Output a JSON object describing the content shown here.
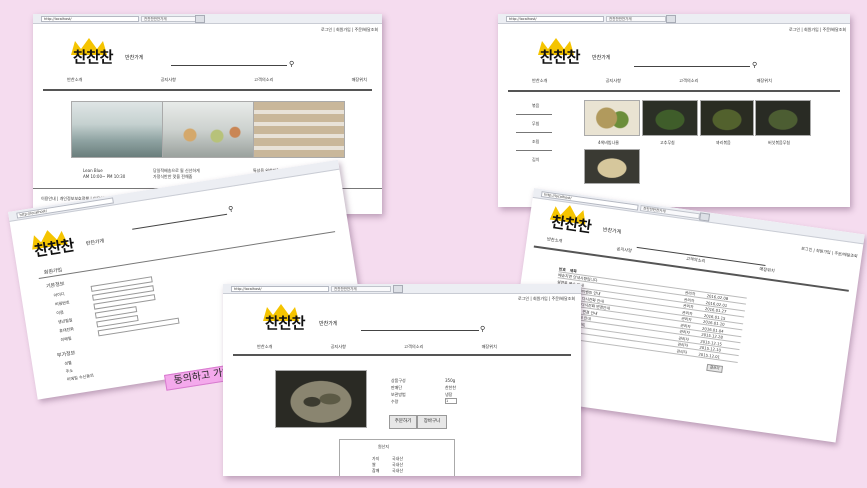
{
  "site": {
    "logo_text": "찬찬찬",
    "logo_sub": "반찬가게",
    "url": "http://localhost/",
    "tab_title": "찬찬찬반찬가게"
  },
  "top_links": "로그인 | 회원가입 | 주문/배달조회",
  "menu": [
    "반찬소개",
    "공지사항",
    "고객의소리",
    "매장위치"
  ],
  "home": {
    "store_info": [
      "Lean Blue",
      "AM 10:00~ PM 10:30"
    ],
    "notice_items": [
      "당일적배송으로 될 신선하게",
      "가정식반찬 맛을 전해줌"
    ],
    "extra_items": [
      "특성을 위한반?",
      "PM 2:00~ 오대반찬 판매"
    ],
    "footer_links": "이용안내 | 개인정보보호정책 | 이용약관"
  },
  "menu_page": {
    "categories": [
      "볶음",
      "무침",
      "조림",
      "김치"
    ],
    "products": [
      "4색비빔나물",
      "고추무침",
      "꽈리볶음",
      "버섯볶음무침"
    ]
  },
  "signup": {
    "title": "회원가입",
    "section_basic": "기본정보",
    "labels": [
      "아이디",
      "비밀번호",
      "이름",
      "생년월일",
      "휴대전화",
      "이메일"
    ],
    "section_extra": "부가정보",
    "extra_labels": [
      "성별",
      "주소",
      "이메일 수신동의"
    ],
    "agree_button": "동의하고 가입"
  },
  "product": {
    "labels": [
      "상품구성",
      "판매단",
      "보관방법",
      "수량"
    ],
    "values": [
      "350g",
      "찬찬찬",
      "냉장",
      "1"
    ],
    "buy_button": "주문하기",
    "cart_button": "장바구니",
    "origin_title": "원산지",
    "origin_rows": [
      [
        "가지",
        "국내산"
      ],
      [
        "쌀",
        "국내산"
      ],
      [
        "참깨",
        "국내산"
      ]
    ]
  },
  "notice_board": {
    "columns": [
      "번호",
      "제목",
      "작성자",
      "작성일"
    ],
    "rows": [
      [
        "10",
        "배송지연 안내사항입니다",
        "관리자",
        "2016.02.08"
      ],
      [
        "9",
        "설연휴 배송 안내",
        "관리자",
        "2016.02.01"
      ],
      [
        "8",
        "2월에 반찬 회원이벤트 안내",
        "관리자",
        "2016.01.27"
      ],
      [
        "7",
        "소스와 반찬사용 다시전화 안내",
        "관리자",
        "2016.01.15"
      ],
      [
        "6",
        "소스와 반찬사용 다시전화 변경안내",
        "관리자",
        "2016.01.10"
      ],
      [
        "5",
        "개인정보처리방침 변경 안내",
        "관리자",
        "2016.01.04"
      ],
      [
        "4",
        "반찬 배달지역 확대 안내",
        "관리자",
        "2015.12.28"
      ],
      [
        "3",
        "홈페이지 오픈 이벤트",
        "관리자",
        "2015.12.15"
      ],
      [
        "2",
        "배송 안내사항",
        "관리자",
        "2015.12.10"
      ],
      [
        "1",
        "찬찬찬 오픈 안내",
        "관리자",
        "2015.12.01"
      ]
    ],
    "write_button": "글쓰기"
  },
  "colors": {
    "background": "#f5dcef",
    "agree_pink": "#f4a9ec",
    "crown_yellow": "#f5c400"
  }
}
